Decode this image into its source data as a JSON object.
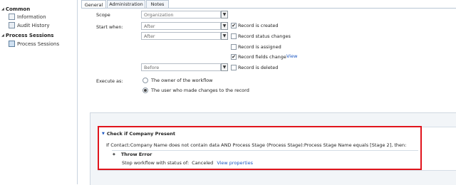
{
  "nav": {
    "common_title": "Common",
    "items": [
      {
        "label": "Information"
      },
      {
        "label": "Audit History"
      }
    ],
    "process_title": "Process Sessions",
    "process_items": [
      {
        "label": "Process Sessions"
      }
    ]
  },
  "tabs": [
    {
      "label": "General",
      "active": true
    },
    {
      "label": "Administration",
      "active": false
    },
    {
      "label": "Notes",
      "active": false
    }
  ],
  "form": {
    "scope_label": "Scope",
    "scope_value": "Organization",
    "start_when_label": "Start when:",
    "start_selects": [
      "After",
      "After",
      "Before"
    ],
    "checkboxes": [
      {
        "label": "Record is created",
        "checked": true
      },
      {
        "label": "Record status changes",
        "checked": false
      },
      {
        "label": "Record is assigned",
        "checked": false
      },
      {
        "label": "Record fields change",
        "checked": true
      },
      {
        "label": "Record is deleted",
        "checked": false
      }
    ],
    "view_link": "View",
    "execute_as_label": "Execute as:",
    "radios": [
      {
        "label": "The owner of the workflow",
        "selected": false
      },
      {
        "label": "The user who made changes to the record",
        "selected": true
      }
    ]
  },
  "designer": {
    "step_title": "Check if Company Present",
    "condition_text": "If Contact:Company Name does not contain data AND Process Stage (Process Stage):Process Stage Name equals [Stage 2], then:",
    "action_title": "Throw Error",
    "stop_text": "Stop workflow with status of:",
    "stop_status": "Canceled",
    "view_properties": "View properties"
  },
  "colors": {
    "highlight_border": "#e0141c",
    "link": "#1a55c2",
    "selected_nav_bg": "#e4eef9"
  }
}
